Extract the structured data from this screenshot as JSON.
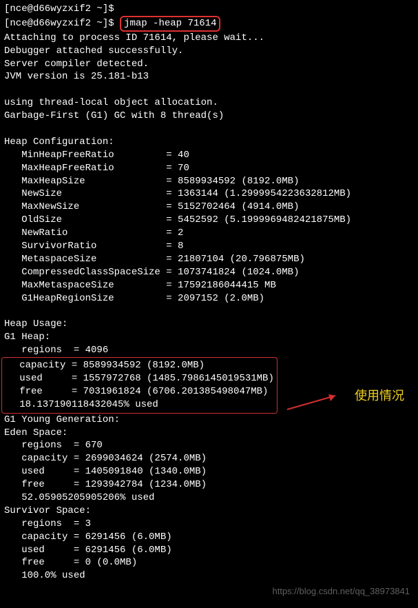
{
  "prompt1": {
    "host": "[nce@d66wyzxif2 ~]$",
    "cmd": ""
  },
  "prompt2": {
    "host": "[nce@d66wyzxif2 ~]$",
    "cmd": "jmap -heap 71614"
  },
  "output": {
    "attaching": "Attaching to process ID 71614, please wait...",
    "debugger": "Debugger attached successfully.",
    "compiler": "Server compiler detected.",
    "jvm": "JVM version is 25.181-b13",
    "blank1": "",
    "tlab": "using thread-local object allocation.",
    "gc": "Garbage-First (G1) GC with 8 thread(s)",
    "blank2": "",
    "heapCfgHdr": "Heap Configuration:",
    "cfg": [
      "   MinHeapFreeRatio         = 40",
      "   MaxHeapFreeRatio         = 70",
      "   MaxHeapSize              = 8589934592 (8192.0MB)",
      "   NewSize                  = 1363144 (1.2999954223632812MB)",
      "   MaxNewSize               = 5152702464 (4914.0MB)",
      "   OldSize                  = 5452592 (5.1999969482421875MB)",
      "   NewRatio                 = 2",
      "   SurvivorRatio            = 8",
      "   MetaspaceSize            = 21807104 (20.796875MB)",
      "   CompressedClassSpaceSize = 1073741824 (1024.0MB)",
      "   MaxMetaspaceSize         = 17592186044415 MB",
      "   G1HeapRegionSize         = 2097152 (2.0MB)"
    ],
    "blank3": "",
    "heapUsageHdr": "Heap Usage:",
    "g1heapHdr": "G1 Heap:",
    "g1heapRegions": "   regions  = 4096",
    "g1heapBox": [
      "   capacity = 8589934592 (8192.0MB)",
      "   used     = 1557972768 (1485.7986145019531MB)",
      "   free     = 7031961824 (6706.201385498047MB)",
      "   18.137190118432045% used"
    ],
    "youngHdr": "G1 Young Generation:",
    "edenHdr": "Eden Space:",
    "eden": [
      "   regions  = 670",
      "   capacity = 2699034624 (2574.0MB)",
      "   used     = 1405091840 (1340.0MB)",
      "   free     = 1293942784 (1234.0MB)",
      "   52.05905205905206% used"
    ],
    "survHdr": "Survivor Space:",
    "surv": [
      "   regions  = 3",
      "   capacity = 6291456 (6.0MB)",
      "   used     = 6291456 (6.0MB)",
      "   free     = 0 (0.0MB)",
      "   100.0% used"
    ]
  },
  "annotation": "使用情况",
  "watermark": "https://blog.csdn.net/qq_38973841"
}
